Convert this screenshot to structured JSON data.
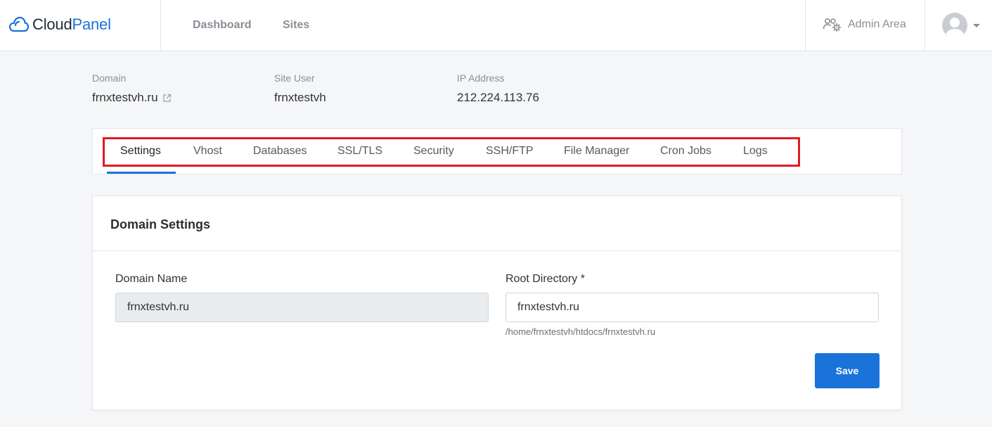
{
  "brand": {
    "part1": "Cloud",
    "part2": "Panel"
  },
  "nav": {
    "dashboard": "Dashboard",
    "sites": "Sites",
    "admin_area": "Admin Area"
  },
  "site_info": {
    "domain_label": "Domain",
    "domain_value": "frnxtestvh.ru",
    "site_user_label": "Site User",
    "site_user_value": "frnxtestvh",
    "ip_label": "IP Address",
    "ip_value": "212.224.113.76"
  },
  "tabs": [
    {
      "label": "Settings"
    },
    {
      "label": "Vhost"
    },
    {
      "label": "Databases"
    },
    {
      "label": "SSL/TLS"
    },
    {
      "label": "Security"
    },
    {
      "label": "SSH/FTP"
    },
    {
      "label": "File Manager"
    },
    {
      "label": "Cron Jobs"
    },
    {
      "label": "Logs"
    }
  ],
  "active_tab": "Settings",
  "card": {
    "title": "Domain Settings",
    "domain_name_label": "Domain Name",
    "domain_name_value": "frnxtestvh.ru",
    "root_dir_label": "Root Directory *",
    "root_dir_value": "frnxtestvh.ru",
    "root_dir_hint": "/home/frnxtestvh/htdocs/frnxtestvh.ru",
    "save_label": "Save"
  },
  "colors": {
    "accent": "#1a73d9",
    "highlight": "#e01b24"
  }
}
